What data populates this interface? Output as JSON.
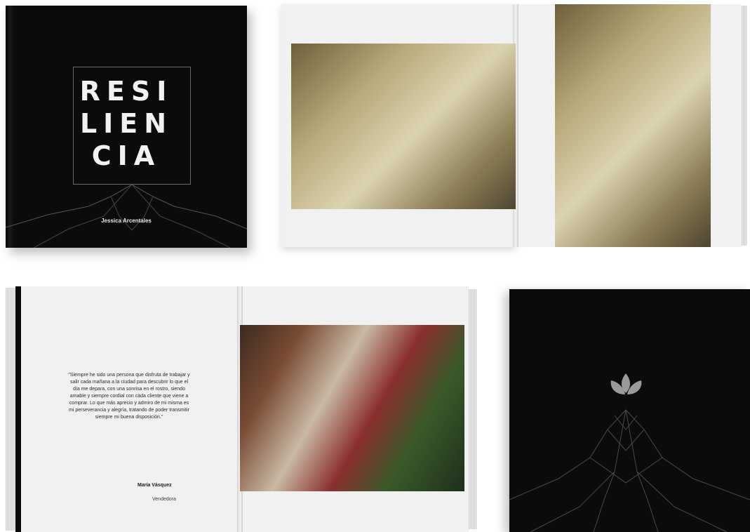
{
  "cover": {
    "title_lines": [
      "RESI",
      "LIEN",
      "CIA"
    ],
    "author": "Jessica Arcentales"
  },
  "quote": {
    "text": "\"Siempre he sido una persona que disfruta de trabajar y salir cada mañana a la ciudad para descubrir lo que el día me depara, con una sonrisa en el rostro, siendo amable y siempre cordial con cada cliente que viene a comprar. Lo que más aprecio y admiro de mi misma es mi perseverancia y alegría, tratando de poder transmitir siempre mi buena disposición.\"",
    "name": "María Vásquez",
    "role": "Vendedora"
  },
  "colors": {
    "cover_black": "#0b0b0b",
    "page_white": "#f1f1f1",
    "line_gray": "#6a6a6a"
  }
}
